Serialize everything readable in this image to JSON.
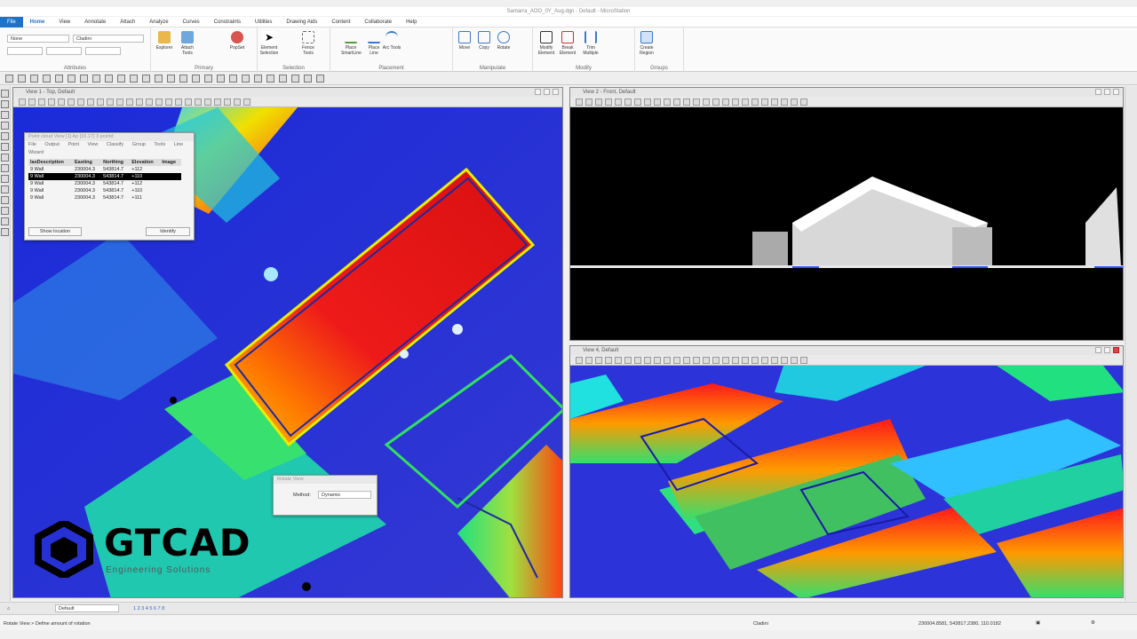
{
  "window": {
    "title": "Samarra_AOO_0Y_Aug.dgn - Default - MicroStation"
  },
  "menu": {
    "file": "File",
    "home": "Home",
    "view": "View",
    "annotate": "Annotate",
    "attach": "Attach",
    "analyze": "Analyze",
    "curves": "Curves",
    "constraints": "Constraints",
    "utilities": "Utilities",
    "drawing_aids": "Drawing Aids",
    "content": "Content",
    "collaborate": "Collaborate",
    "help": "Help"
  },
  "ribbon": {
    "attributes_label": "Attributes",
    "primary_label": "Primary",
    "selection_label": "Selection",
    "placement_label": "Placement",
    "manipulate_label": "Manipulate",
    "modify_label": "Modify",
    "groups_label": "Groups",
    "level_value": "None",
    "level2_value": "Cladini",
    "explorer": "Explorer",
    "attach_tools": "Attach Tools",
    "popset": "PopSet",
    "element_selection": "Element Selection",
    "fence_tools": "Fence Tools",
    "place_smartline": "Place SmartLine",
    "place_line": "Place Line",
    "arc_tools": "Arc Tools",
    "move": "Move",
    "copy": "Copy",
    "rotate": "Rotate",
    "modify_element": "Modify Element",
    "break_element": "Break Element",
    "trim_multiple": "Trim Multiple",
    "create_region": "Create Region"
  },
  "views": {
    "v1_title": "View 1 - Top, Default",
    "v2_title": "View 2 - Front, Default",
    "v4_title": "View 4, Default"
  },
  "point_dialog": {
    "title": "Point cloud View [1] Ap [16.17] 3 pointd",
    "menu": [
      "File",
      "Output",
      "Point",
      "View",
      "Classify",
      "Group",
      "Tools",
      "Line"
    ],
    "wizard": "Wizard",
    "columns": [
      "lasDescription",
      "Easting",
      "Northing",
      "Elevation",
      "Image"
    ],
    "rows": [
      [
        "9 Wall",
        "230004.3",
        "543814.7",
        "+112",
        ""
      ],
      [
        "9 Wall",
        "230004.3",
        "543814.7",
        "+110",
        ""
      ],
      [
        "9 Wall",
        "230004.3",
        "543814.7",
        "+112",
        ""
      ],
      [
        "9 Wall",
        "230004.3",
        "543814.7",
        "+110",
        ""
      ],
      [
        "9 Wall",
        "230004.3",
        "543814.7",
        "+111",
        ""
      ]
    ],
    "selected_row": 1,
    "show_location": "Show location",
    "identify": "Identify"
  },
  "rotate_dialog": {
    "title": "Rotate View",
    "method_label": "Method:",
    "method_value": "Dynamic"
  },
  "status": {
    "model": "Default",
    "prompt": "Rotate View > Define amount of rotation",
    "level": "Cladini",
    "coords": "230004.8581, 543817.2380, 110.0182"
  },
  "watermark": {
    "brand": "GTCAD",
    "tagline": "Engineering Solutions"
  },
  "colors": {
    "accent": "#1e73c9",
    "close": "#e04343"
  }
}
